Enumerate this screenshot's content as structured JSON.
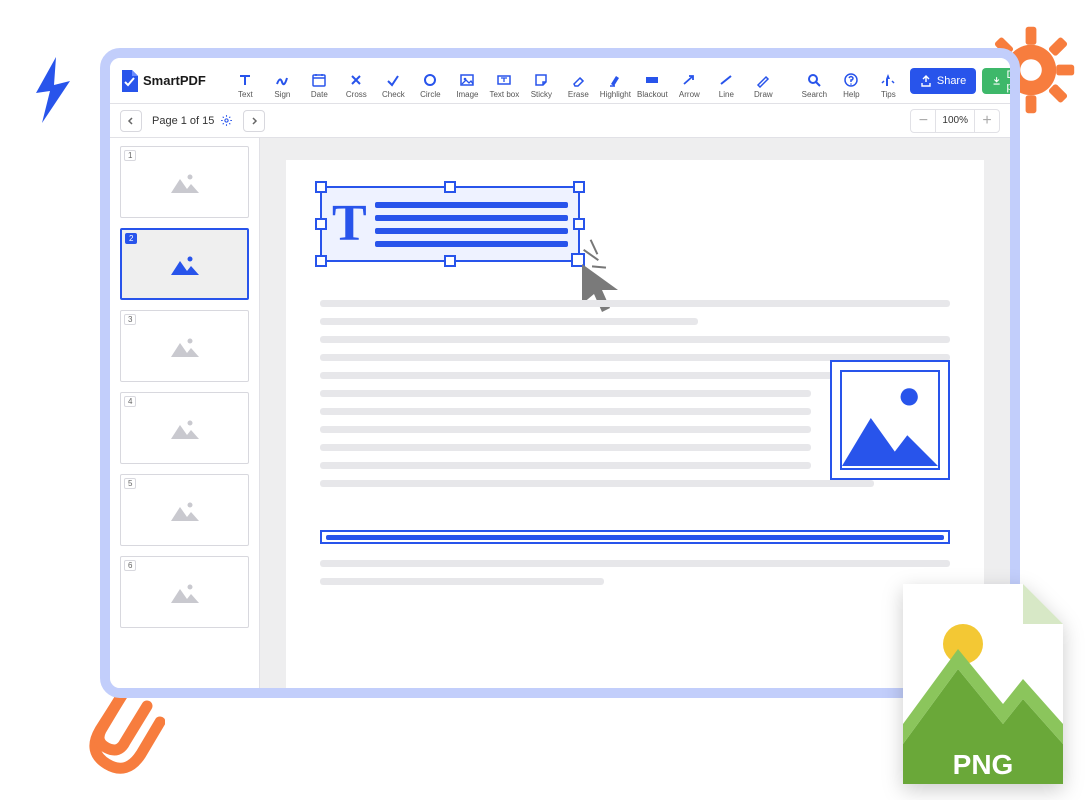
{
  "brand": {
    "name": "SmartPDF"
  },
  "tools": [
    {
      "id": "text",
      "label": "Text"
    },
    {
      "id": "sign",
      "label": "Sign"
    },
    {
      "id": "date",
      "label": "Date"
    },
    {
      "id": "cross",
      "label": "Cross"
    },
    {
      "id": "check",
      "label": "Check"
    },
    {
      "id": "circle",
      "label": "Circle"
    },
    {
      "id": "image",
      "label": "Image"
    },
    {
      "id": "textbox",
      "label": "Text box"
    },
    {
      "id": "sticky",
      "label": "Sticky"
    },
    {
      "id": "erase",
      "label": "Erase"
    },
    {
      "id": "highlight",
      "label": "Highlight"
    },
    {
      "id": "blackout",
      "label": "Blackout"
    },
    {
      "id": "arrow",
      "label": "Arrow"
    },
    {
      "id": "line",
      "label": "Line"
    },
    {
      "id": "draw",
      "label": "Draw"
    }
  ],
  "help_tools": [
    {
      "id": "search",
      "label": "Search"
    },
    {
      "id": "help",
      "label": "Help"
    },
    {
      "id": "tips",
      "label": "Tips"
    }
  ],
  "actions": {
    "share": "Share",
    "download": "Download pdf"
  },
  "pager": {
    "label": "Page 1 of 15"
  },
  "zoom": {
    "value": "100%"
  },
  "thumbnails": [
    {
      "n": "1",
      "active": false
    },
    {
      "n": "2",
      "active": true
    },
    {
      "n": "3",
      "active": false
    },
    {
      "n": "4",
      "active": false
    },
    {
      "n": "5",
      "active": false
    },
    {
      "n": "6",
      "active": false
    }
  ],
  "overlay": {
    "file_badge": "PNG"
  },
  "colors": {
    "primary": "#2854eb",
    "success": "#3eb86a",
    "accent_orange": "#f77d3e"
  }
}
